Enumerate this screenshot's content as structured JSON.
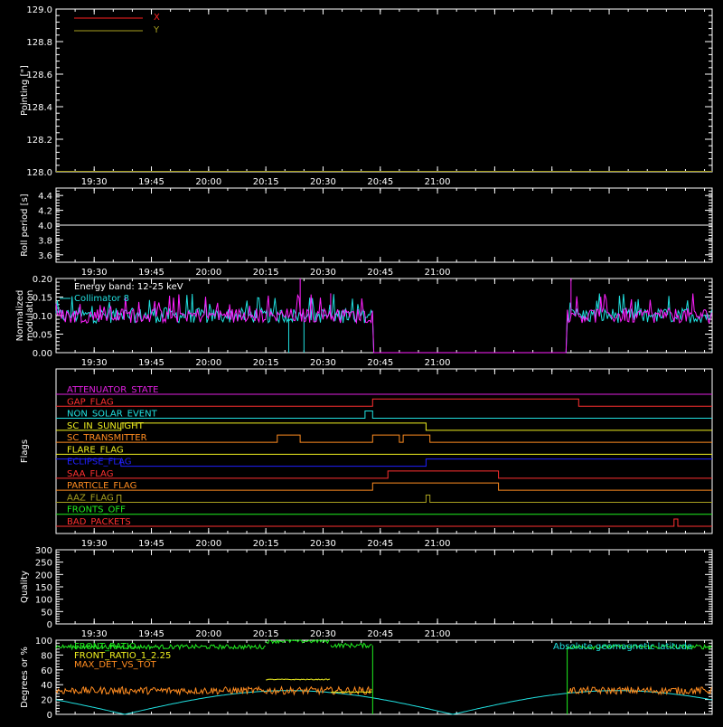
{
  "colors": {
    "background": "#000000",
    "foreground": "#ffffff",
    "red": "#ff2020",
    "olive": "#a8a020",
    "cyan": "#20e0e0",
    "magenta": "#ff20ff",
    "green": "#20f020",
    "yellow": "#f0f020",
    "orange": "#ff8c20",
    "blue": "#2020ff",
    "flag_colors": [
      "#e020e0",
      "#ff3030",
      "#20e0e0",
      "#f0f020",
      "#ff8c20",
      "#f0f020",
      "#2020ff",
      "#ff3030",
      "#ff8c20",
      "#a8a020",
      "#20f020",
      "#ff3030"
    ]
  },
  "time_axis": {
    "range_min": [
      1400,
      1572
    ],
    "tick_values_min": [
      1410,
      1425,
      1440,
      1455,
      1470,
      1485,
      1500,
      1515,
      1530,
      1545
    ],
    "tick_labels": [
      "19:30",
      "19:45",
      "20:00",
      "20:15",
      "20:30",
      "20:45",
      "21:00"
    ]
  },
  "chart_data": [
    {
      "type": "line",
      "id": "pointing",
      "ylabel": "Pointing [\"]",
      "ylim": [
        128.0,
        129.0
      ],
      "yticks": [
        128.0,
        128.2,
        128.4,
        128.6,
        128.8,
        129.0
      ],
      "ytick_labels": [
        "128.0",
        "128.2",
        "128.4",
        "128.6",
        "128.8",
        "129.0"
      ],
      "legend": [
        "X",
        "Y"
      ],
      "legend_placement": "top-left",
      "series": [
        {
          "name": "X",
          "color": "#ff2020",
          "values": []
        },
        {
          "name": "Y",
          "color": "#a8a020",
          "values": []
        }
      ]
    },
    {
      "type": "line",
      "id": "roll",
      "ylabel": "Roll period [s]",
      "ylim": [
        3.5,
        4.5
      ],
      "yticks": [
        3.6,
        3.8,
        4.0,
        4.2,
        4.4
      ],
      "ytick_labels": [
        "3.6",
        "3.8",
        "4.0",
        "4.2",
        "4.4"
      ],
      "series": [
        {
          "color": "#ffffff",
          "x": [
            1400,
            1572
          ],
          "y": [
            4.0,
            4.0
          ]
        }
      ]
    },
    {
      "type": "line",
      "id": "modulation",
      "ylabel_lines": [
        "Normalized",
        "modulation"
      ],
      "ylim": [
        0.0,
        0.2
      ],
      "yticks": [
        0.0,
        0.05,
        0.1,
        0.15,
        0.2
      ],
      "ytick_labels": [
        "0.00",
        "0.05",
        "0.10",
        "0.15",
        "0.20"
      ],
      "annotations": [
        "Energy band: 12-25 keV",
        "Collimator 8"
      ],
      "series": [
        {
          "name": "Collimator 8",
          "color": "#20e0e0",
          "base": 0.1,
          "noise": 0.02,
          "active": [
            [
              1400,
              1483
            ],
            [
              1534,
              1572
            ]
          ],
          "spikes": [
            [
              1461,
              0.0
            ],
            [
              1465,
              0.0
            ]
          ]
        },
        {
          "color": "#ff20ff",
          "base": 0.1,
          "noise": 0.02,
          "active": [
            [
              1400,
              1483
            ],
            [
              1534,
              1572
            ]
          ],
          "spikes": [
            [
              1464,
              0.2
            ],
            [
              1535,
              0.2
            ],
            [
              1472,
              0.16
            ]
          ]
        }
      ]
    },
    {
      "type": "line",
      "id": "flags",
      "ylabel": "Flags",
      "flags": [
        {
          "name": "ATTENUATOR_STATE",
          "changes": []
        },
        {
          "name": "GAP_FLAG",
          "changes": [
            [
              1483,
              1
            ],
            [
              1537,
              0
            ]
          ]
        },
        {
          "name": "NON_SOLAR_EVENT",
          "changes": [
            [
              1481,
              1
            ],
            [
              1483,
              0
            ]
          ]
        },
        {
          "name": "SC_IN_SUNLIGHT",
          "changes": [
            [
              1417,
              1
            ],
            [
              1497,
              0
            ]
          ]
        },
        {
          "name": "SC_TRANSMITTER",
          "changes": [
            [
              1458,
              1
            ],
            [
              1464,
              0
            ],
            [
              1483,
              1
            ],
            [
              1490,
              0
            ],
            [
              1491,
              1
            ],
            [
              1498,
              0
            ]
          ]
        },
        {
          "name": "FLARE_FLAG",
          "changes": []
        },
        {
          "name": "ECLIPSE_FLAG",
          "changes": [
            [
              1417,
              0
            ],
            [
              1497,
              1
            ]
          ]
        },
        {
          "name": "SAA_FLAG",
          "changes": [
            [
              1487,
              1
            ],
            [
              1516,
              0
            ]
          ]
        },
        {
          "name": "PARTICLE_FLAG",
          "changes": [
            [
              1483,
              1
            ],
            [
              1516,
              0
            ]
          ]
        },
        {
          "name": "AAZ_FLAG",
          "changes": [
            [
              1416,
              1
            ],
            [
              1417,
              0
            ],
            [
              1497,
              1
            ],
            [
              1498,
              0
            ]
          ]
        },
        {
          "name": "FRONTS_OFF",
          "changes": []
        },
        {
          "name": "BAD_PACKETS",
          "changes": [
            [
              1562,
              1
            ],
            [
              1563,
              0
            ]
          ]
        }
      ]
    },
    {
      "type": "line",
      "id": "quality",
      "ylabel": "Quality",
      "ylim": [
        0,
        300
      ],
      "yticks": [
        0,
        50,
        100,
        150,
        200,
        250,
        300
      ],
      "ytick_labels": [
        "0",
        "50",
        "100",
        "150",
        "200",
        "250",
        "300"
      ],
      "series": []
    },
    {
      "type": "line",
      "id": "ratios",
      "ylabel": "Degrees or %",
      "ylim": [
        0,
        100
      ],
      "yticks": [
        0,
        20,
        40,
        60,
        80,
        100
      ],
      "ytick_labels": [
        "0",
        "20",
        "40",
        "60",
        "80",
        "100"
      ],
      "legend": [
        "FRONT_RATIO",
        "FRONT_RATIO_1_2.25",
        "MAX_DET_VS_TOT"
      ],
      "legend_placement": "top-left",
      "annotations": [
        "Absolute geomagnetic latitude"
      ],
      "series": [
        {
          "name": "FRONT_RATIO",
          "color": "#20f020",
          "segments": [
            [
              1400,
              1455,
              91
            ],
            [
              1455,
              1472,
              99
            ],
            [
              1472,
              1483,
              93
            ],
            [
              1534,
              1572,
              91
            ]
          ],
          "noise": 3
        },
        {
          "name": "FRONT_RATIO_1_2.25",
          "color": "#f0f020",
          "segments": [
            [
              1455,
              1472,
              47
            ],
            [
              1472,
              1483,
              30
            ]
          ],
          "noise": 0.6
        },
        {
          "name": "MAX_DET_VS_TOT",
          "color": "#ff8c20",
          "segments": [
            [
              1400,
              1483,
              32
            ],
            [
              1534,
              1572,
              32
            ]
          ],
          "noise": 5
        },
        {
          "name": "Absolute geomagnetic latitude",
          "color": "#20e0e0",
          "x": [
            1400,
            1418,
            1436,
            1454,
            1472,
            1490,
            1508,
            1526,
            1544,
            1562,
            1572
          ],
          "y": [
            14,
            0,
            14,
            28,
            5,
            0,
            25,
            28,
            12,
            0,
            10
          ],
          "abs_sine": {
            "amp": 32,
            "period": 86,
            "zero": 1418
          }
        }
      ]
    }
  ]
}
